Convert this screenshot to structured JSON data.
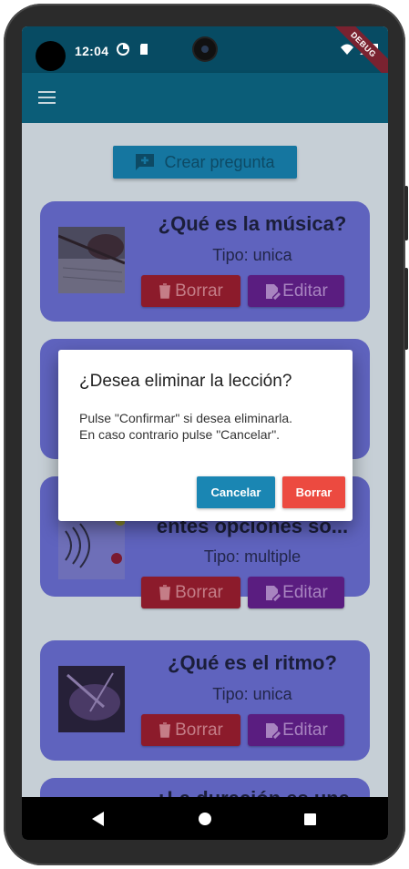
{
  "status_bar": {
    "time": "12:04",
    "debug_banner": "DEBUG"
  },
  "app_bar": {
    "menu_icon": "hamburger-menu-icon"
  },
  "toolbar": {
    "create_label": "Crear pregunta",
    "create_icon": "add-comment-icon"
  },
  "questions": [
    {
      "title": "¿Qué es la música?",
      "type": "Tipo: unica",
      "delete_label": "Borrar",
      "edit_label": "Editar"
    },
    {
      "title": "",
      "type": "",
      "delete_label": "",
      "edit_label": ""
    },
    {
      "title": "entes opciones so...",
      "type": "Tipo: multiple",
      "delete_label": "Borrar",
      "edit_label": "Editar"
    },
    {
      "title": "¿Qué es el ritmo?",
      "type": "Tipo: unica",
      "delete_label": "Borrar",
      "edit_label": "Editar"
    },
    {
      "title": "¿La duración es una",
      "type": "",
      "delete_label": "",
      "edit_label": ""
    }
  ],
  "dialog": {
    "title": "¿Desea eliminar la lección?",
    "body_line1": "Pulse \"Confirmar\" si desea eliminarla.",
    "body_line2": "En caso contrario pulse \"Cancelar\".",
    "cancel_label": "Cancelar",
    "confirm_label": "Borrar"
  },
  "colors": {
    "app_bar": "#0b5d78",
    "card": "#5f63be",
    "delete": "#8c1b2b",
    "edit": "#5a1d80",
    "dialog_cancel": "#1a86b3",
    "dialog_confirm": "#ec4a40"
  }
}
